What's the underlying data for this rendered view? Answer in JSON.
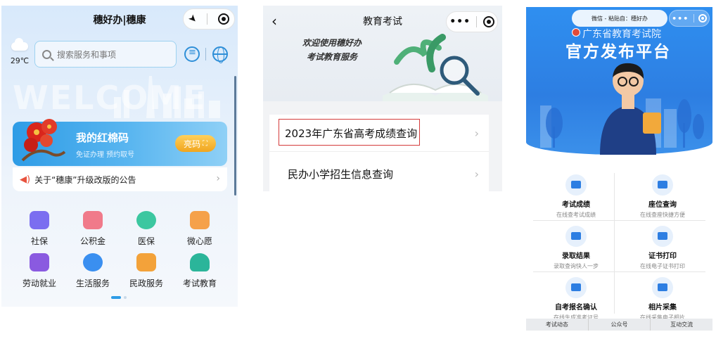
{
  "panel1": {
    "title": "穗好办|穗康",
    "weather": {
      "temp": "29℃",
      "icon": "cloud-icon"
    },
    "search": {
      "placeholder": "搜索服务和事项"
    },
    "card": {
      "title": "我的红棉码",
      "subtitle": "免证办理  预约取号",
      "button": "亮码"
    },
    "notice": "关于“穗康”升级改版的公告",
    "services": [
      {
        "label": "社保",
        "color": "#7b6ef0"
      },
      {
        "label": "公积金",
        "color": "#f07a8a"
      },
      {
        "label": "医保",
        "color": "#3cc7a0"
      },
      {
        "label": "微心愿",
        "color": "#f5a14a"
      },
      {
        "label": "劳动就业",
        "color": "#8a5ae0"
      },
      {
        "label": "生活服务",
        "color": "#3a8ff0"
      },
      {
        "label": "民政服务",
        "color": "#f3a23a"
      },
      {
        "label": "考试教育",
        "color": "#2bb59a"
      }
    ]
  },
  "panel2": {
    "title": "教育考试",
    "welcome_line1": "欢迎使用穗好办",
    "welcome_line2": "考试教育服务",
    "items": [
      {
        "label": "2023年广东省高考成绩查询"
      },
      {
        "label": "民办小学招生信息查询"
      }
    ]
  },
  "panel3": {
    "source_pill": "微信 - 粘贴自：穗好办",
    "org": "广东省教育考试院",
    "headline": "官方发布平台",
    "tiles": [
      {
        "title": "考试成绩",
        "sub": "在线查考试成绩"
      },
      {
        "title": "座位查询",
        "sub": "在线查座快捷方便"
      },
      {
        "title": "录取结果",
        "sub": "录取查询快人一步"
      },
      {
        "title": "证书打印",
        "sub": "在线电子证书打印"
      },
      {
        "title": "自考报名确认",
        "sub": "在线生成准考证号"
      },
      {
        "title": "相片采集",
        "sub": "在线采集电子相片"
      }
    ],
    "tabs": [
      "考试动态",
      "公众号",
      "互动交流"
    ]
  }
}
